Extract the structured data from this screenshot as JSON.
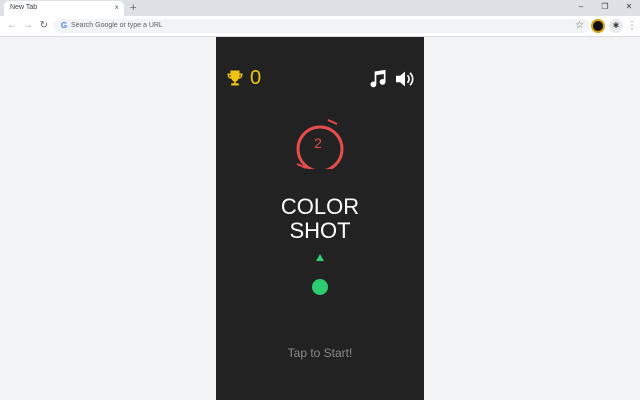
{
  "browser": {
    "tab": {
      "title": "New Tab",
      "close_glyph": "×"
    },
    "new_tab_glyph": "+",
    "window_controls": {
      "minimize": "–",
      "restore": "❐",
      "close": "✕"
    },
    "nav": {
      "back": "←",
      "forward": "→",
      "reload": "↻"
    },
    "omnibox": {
      "icon_letter": "G",
      "placeholder": "Search Google or type a URL"
    },
    "bookmark_glyph": "☆",
    "extensions_glyph": "✱",
    "menu_glyph": "⋮"
  },
  "game": {
    "score": "0",
    "ring_number": "2",
    "title_line1": "COLOR",
    "title_line2": "SHOT",
    "start_prompt": "Tap to Start!",
    "colors": {
      "background": "#222222",
      "score": "#f1c40f",
      "ring": "#e74c4c",
      "ball": "#2ecc71",
      "arrow": "#2ecc71"
    },
    "icons": [
      "trophy-icon",
      "music-icon",
      "sound-icon"
    ]
  }
}
